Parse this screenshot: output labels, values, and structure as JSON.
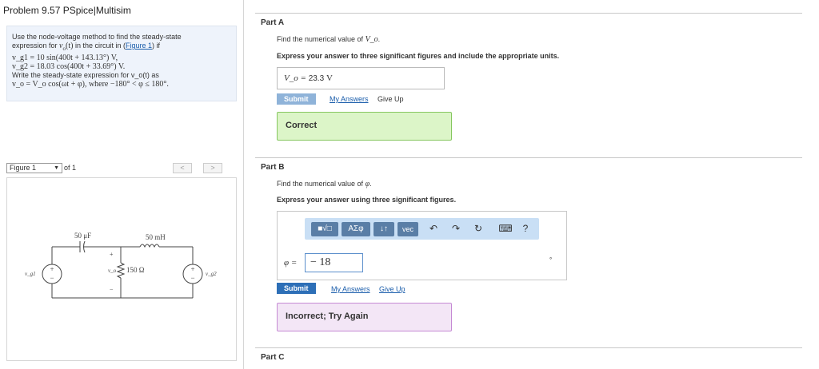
{
  "header": {
    "title": "Problem 9.57 PSpice|Multisim"
  },
  "problem": {
    "line1": "Use the node-voltage method to find the steady-state",
    "line2a": "expression for ",
    "line2b": "v",
    "line2c": "o",
    "line2d": "(t)",
    "line2e": " in the circuit in (",
    "figure_link": "Figure 1",
    "line2f": ") if",
    "vg1": "v_g1 = 10 sin(400t + 143.13°) V,",
    "vg2": "v_g2 = 18.03 cos(400t + 33.69°) V.",
    "line5": "Write the steady-state expression for v_o(t) as",
    "line6": "v_o = V_o cos(ωt + φ), where −180° < φ ≤ 180°."
  },
  "figure": {
    "selected": "Figure 1",
    "of": "of 1",
    "prev": "<",
    "next": ">",
    "labels": {
      "cap": "50 μF",
      "ind": "50 mH",
      "res": "150 Ω",
      "vg1": "v_g1",
      "vg2": "v_g2",
      "vo": "v_o",
      "plus": "+",
      "minus": "−"
    }
  },
  "partA": {
    "label": "Part A",
    "prompt_pre": "Find the numerical value of ",
    "prompt_var": "V_o",
    "prompt_post": ".",
    "instruction": "Express your answer to three significant figures and include the appropriate units.",
    "answer_label": "V_o =",
    "answer_value": "23.3",
    "answer_unit": "V",
    "submit": "Submit",
    "my_answers": "My Answers",
    "give_up": "Give Up",
    "feedback": "Correct"
  },
  "partB": {
    "label": "Part B",
    "prompt_pre": "Find the numerical value of ",
    "prompt_var": "φ",
    "prompt_post": ".",
    "instruction": "Express your answer using three significant figures.",
    "toolbar": {
      "templates": "■√□",
      "greek": "ΑΣφ",
      "arrows": "↓↑",
      "vec": "vec",
      "undo": "↶",
      "redo": "↷",
      "reset": "↻",
      "keyboard": "⌨",
      "help": "?"
    },
    "answer_label": "φ =",
    "answer_value": "− 18",
    "unit": "°",
    "submit": "Submit",
    "my_answers": "My Answers",
    "give_up": "Give Up",
    "feedback": "Incorrect; Try Again"
  },
  "partC": {
    "label": "Part C"
  },
  "colors": {
    "submit_disabled": "#8fb3d9",
    "submit_active": "#2d6fb7",
    "correct_bg": "#dcf5c8",
    "incorrect_bg": "#f3e6f6"
  }
}
